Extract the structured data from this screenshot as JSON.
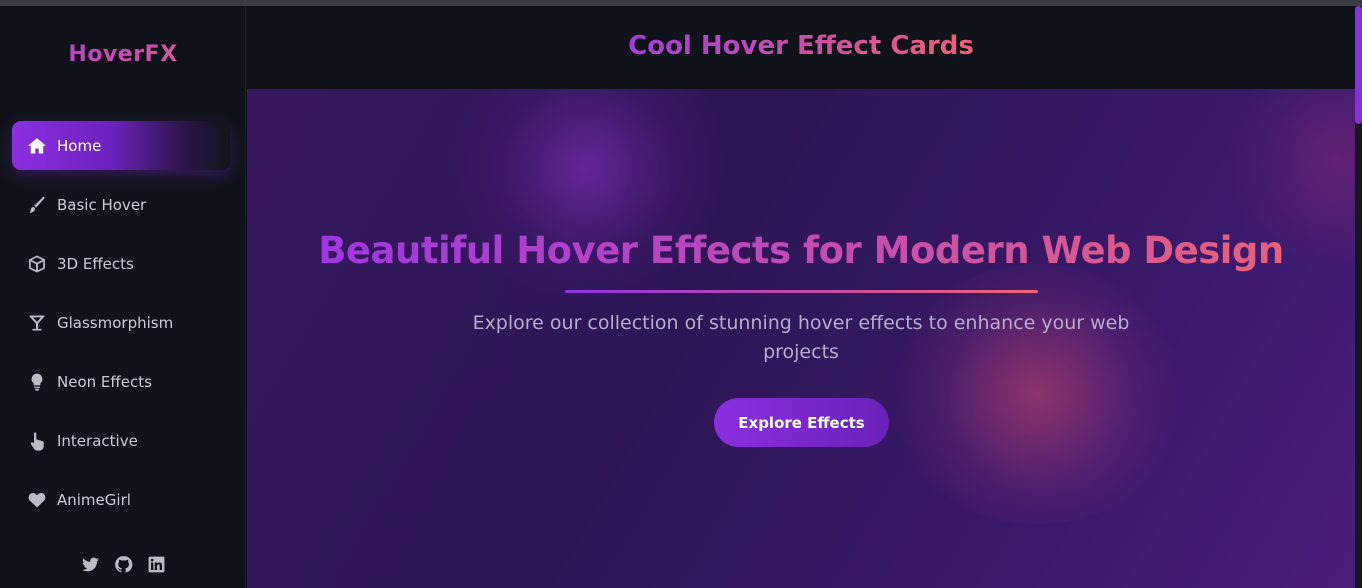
{
  "sidebar": {
    "brand": "HoverFX",
    "items": [
      {
        "label": "Home",
        "icon": "home-icon",
        "active": true
      },
      {
        "label": "Basic Hover",
        "icon": "paintbrush-icon",
        "active": false
      },
      {
        "label": "3D Effects",
        "icon": "cube-icon",
        "active": false
      },
      {
        "label": "Glassmorphism",
        "icon": "cocktail-glass-icon",
        "active": false
      },
      {
        "label": "Neon Effects",
        "icon": "lightbulb-icon",
        "active": false
      },
      {
        "label": "Interactive",
        "icon": "hand-pointer-icon",
        "active": false
      },
      {
        "label": "AnimeGirl",
        "icon": "heart-icon",
        "active": false
      }
    ],
    "socials": [
      "twitter-icon",
      "github-icon",
      "linkedin-icon"
    ]
  },
  "header": {
    "title": "Cool Hover Effect Cards"
  },
  "hero": {
    "title": "Beautiful Hover Effects for Modern Web Design",
    "subtitle": "Explore our collection of stunning hover effects to enhance your web projects",
    "button_label": "Explore Effects"
  },
  "colors": {
    "accent_purple": "#8a2fe0",
    "accent_pink": "#f0636f",
    "sidebar_bg": "#0f1319",
    "hero_bg": "#2d1655"
  }
}
